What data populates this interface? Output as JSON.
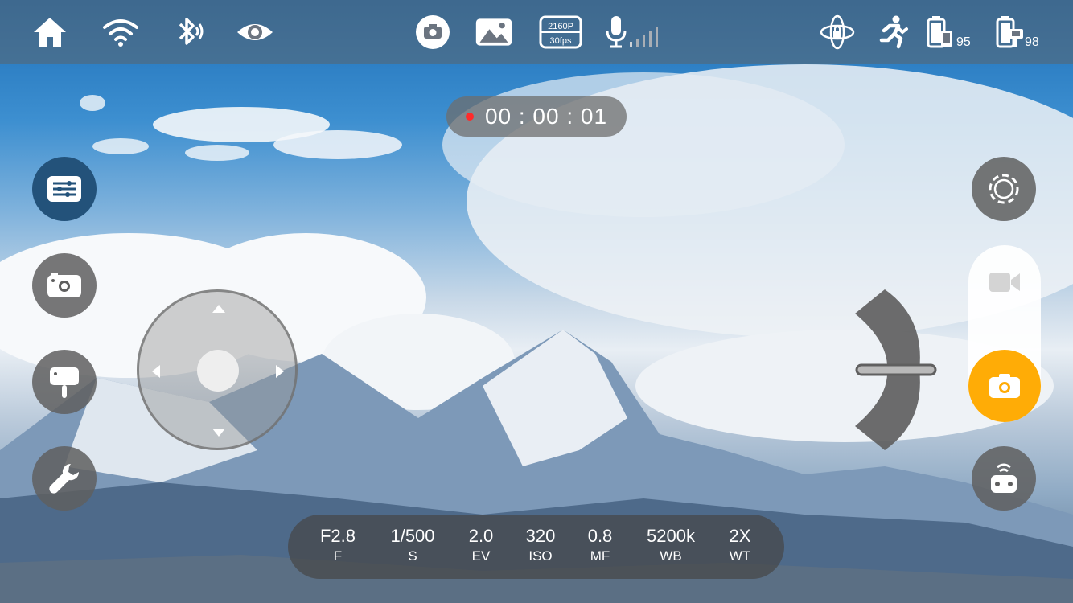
{
  "top_bar": {
    "icons": [
      "home-icon",
      "wifi-icon",
      "bluetooth-icon",
      "eye-icon",
      "camera-icon",
      "gallery-icon",
      "resolution-badge",
      "microphone-icon",
      "gimbal-lock-icon",
      "sport-mode-icon",
      "phone-battery-icon",
      "gimbal-battery-icon"
    ],
    "resolution": "2160P",
    "fps": "30fps",
    "phone_battery": "95",
    "gimbal_battery": "98"
  },
  "recording": {
    "timer": "00 : 00 : 01",
    "dot_color": "#ff2a2a"
  },
  "left_buttons": [
    "settings-sliders-icon",
    "camera-icon",
    "gimbal-icon",
    "wrench-icon"
  ],
  "right_buttons": [
    "target-icon",
    "video-icon",
    "shutter-icon",
    "remote-icon"
  ],
  "shutter_color": "#ffac06",
  "params": [
    {
      "value": "F2.8",
      "label": "F"
    },
    {
      "value": "1/500",
      "label": "S"
    },
    {
      "value": "2.0",
      "label": "EV"
    },
    {
      "value": "320",
      "label": "ISO"
    },
    {
      "value": "0.8",
      "label": "MF"
    },
    {
      "value": "5200k",
      "label": "WB"
    },
    {
      "value": "2X",
      "label": "WT"
    }
  ]
}
